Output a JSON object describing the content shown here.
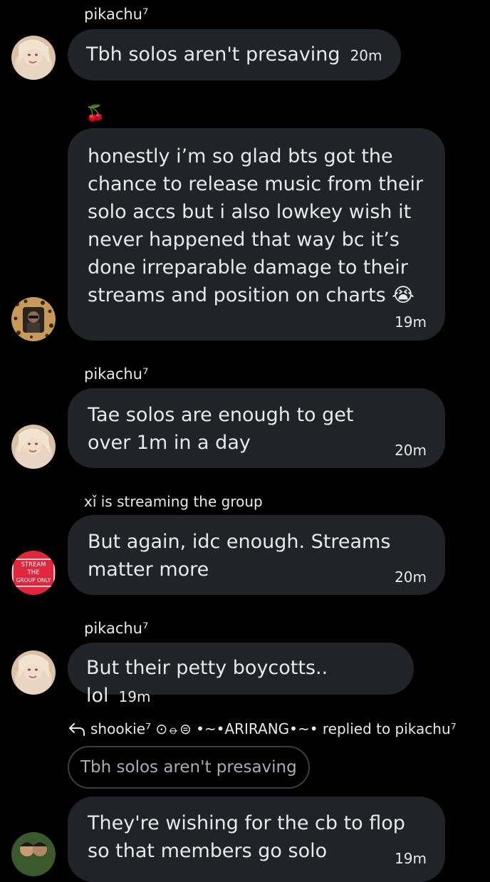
{
  "colors": {
    "background": "#000000",
    "bubble": "#202327",
    "text": "#e7e9ea",
    "quote_border": "#3a3d41",
    "badge_red": "#e0263c"
  },
  "messages": [
    {
      "sender": "pikachu⁷",
      "text": "Tbh solos aren't presaving",
      "time": "20m",
      "avatar": "pikachu-avatar"
    },
    {
      "sender_emoji": "🍒",
      "text": "honestly i’m so glad bts got the chance to release music from their solo accs but i also lowkey wish it never happened that way bc it’s done irreparable damage to their streams and position on charts 😭",
      "time": "19m",
      "avatar": "leopard-frame-avatar"
    },
    {
      "sender": "pikachu⁷",
      "text": "Tae solos are enough to get over 1m in a day",
      "time": "20m",
      "avatar": "pikachu-avatar"
    },
    {
      "sender": "xǐ is streaming the group",
      "text": "But again, idc enough. Streams matter more",
      "time": "20m",
      "avatar": "stream-badge-avatar",
      "avatar_badge_lines": [
        "STREAM",
        "THE",
        "GROUP ONLY"
      ]
    },
    {
      "sender": "pikachu⁷",
      "text": "But their petty boycotts.. lol",
      "time": "19m",
      "avatar": "pikachu-avatar"
    },
    {
      "reply_header": "shookie⁷ ⊙⦵⊜ •~•ARIRANG•~• replied to pikachu⁷",
      "quoted_text": "Tbh solos aren't presaving",
      "text": "They're wishing for the cb to flop so that members go solo",
      "time": "19m",
      "avatar": "couple-avatar"
    }
  ]
}
